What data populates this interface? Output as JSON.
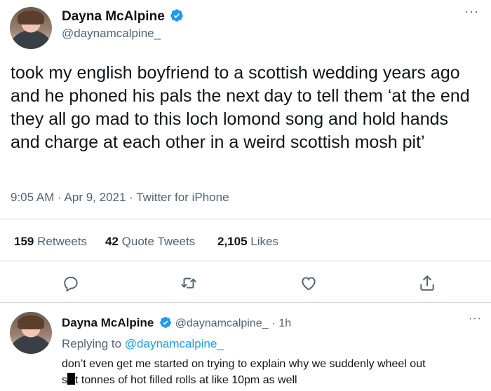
{
  "tweet": {
    "author_name": "Dayna McAlpine",
    "author_handle": "@daynamcalpine_",
    "more_icon": "more-dots-icon",
    "text": "took my english boyfriend to a scottish wedding years ago and he phoned his pals the next day to tell them ‘at the end they all go mad to this loch lomond song and hold hands and charge at each other in a weird scottish mosh pit’",
    "timestamp": "9:05 AM · Apr 9, 2021 · Twitter for iPhone",
    "stats": {
      "retweets_count": "159",
      "retweets_label": "Retweets",
      "quote_count": "42",
      "quote_label": "Quote Tweets",
      "likes_count": "2,105",
      "likes_label": "Likes"
    },
    "actions": [
      "reply-icon",
      "retweet-icon",
      "like-icon",
      "share-icon"
    ]
  },
  "reply": {
    "author_name": "Dayna McAlpine",
    "author_handle": "@daynamcalpine_",
    "separator": "·",
    "time": "1h",
    "replying_to_prefix": "Replying to",
    "replying_to_handle": "@daynamcalpine_",
    "text_line1": "don’t even get me started on trying to explain why we suddenly wheel out",
    "text_line2_start": "s",
    "text_line2_end": "t tonnes of hot filled rolls at like 10pm as well"
  },
  "colors": {
    "accent": "#1d9bf0",
    "text": "#0f1419",
    "muted": "#536471",
    "divider": "#cfd9de"
  }
}
